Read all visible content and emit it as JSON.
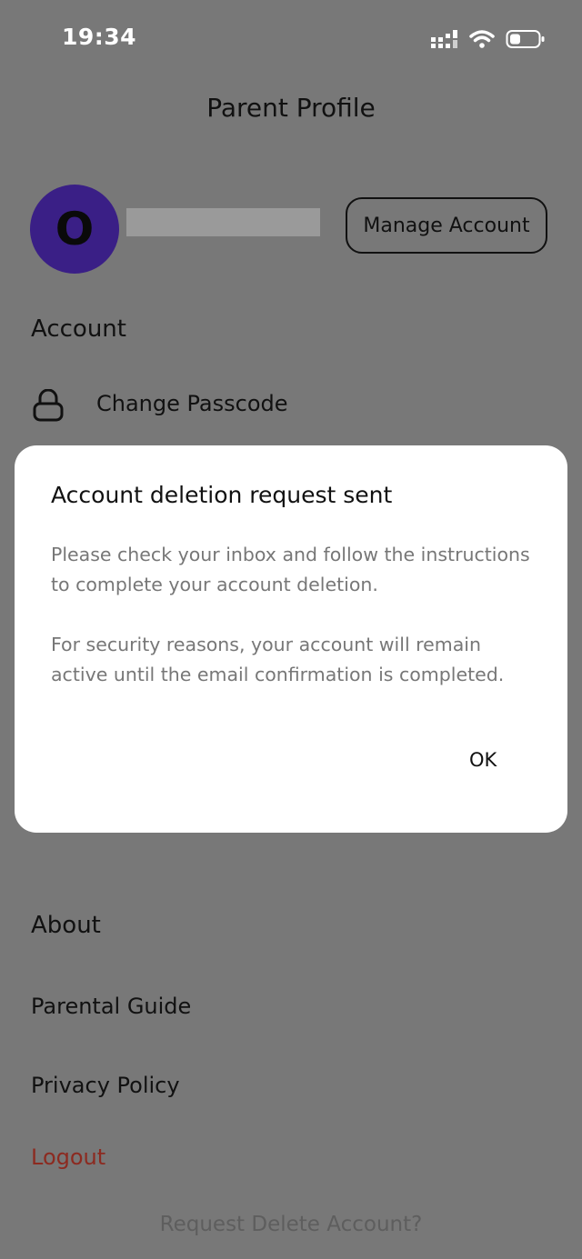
{
  "status_bar": {
    "time": "19:34",
    "signal_icon": "cellular-signal-icon",
    "wifi_icon": "wifi-icon",
    "battery_icon": "battery-icon"
  },
  "header": {
    "title": "Parent Profile"
  },
  "profile": {
    "avatar_initial": "O",
    "manage_account_label": "Manage Account"
  },
  "account": {
    "heading": "Account",
    "change_passcode_label": "Change Passcode",
    "lock_icon": "lock-icon"
  },
  "dialog": {
    "title": "Account deletion request sent",
    "body_paragraph_1": "Please check your inbox and follow the instructions to complete your account deletion.",
    "body_paragraph_2": "For security reasons, your account will remain active until the email confirmation is completed.",
    "ok_label": "OK"
  },
  "about": {
    "heading": "About",
    "parental_guide_label": "Parental Guide",
    "privacy_policy_label": "Privacy Policy"
  },
  "logout_label": "Logout",
  "request_delete_label": "Request Delete Account?",
  "colors": {
    "background_dimmed": "#787878",
    "avatar": "#3a1f86",
    "logout": "#8c2a20",
    "dialog": "#ffffff"
  }
}
